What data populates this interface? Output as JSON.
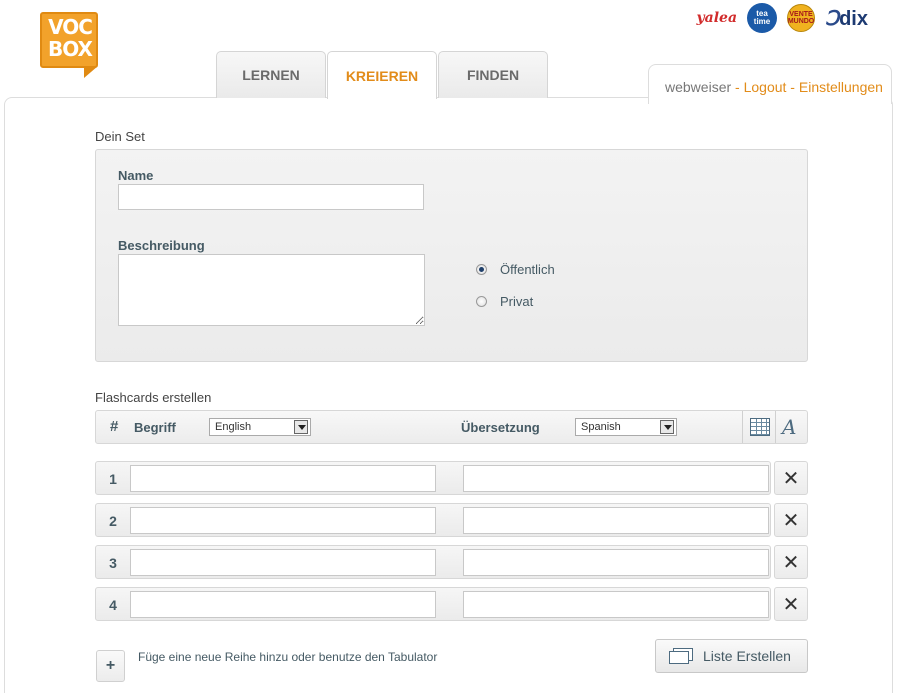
{
  "logo": {
    "text_line1": "VOC",
    "text_line2": "BOX"
  },
  "partners": {
    "yalea": "yalea",
    "teatime": "tea time",
    "vente": "VENTE MUNDO",
    "dix": "dix"
  },
  "tabs": [
    {
      "label": "LERNEN"
    },
    {
      "label": "KREIEREN",
      "active": true
    },
    {
      "label": "FINDEN"
    }
  ],
  "user": {
    "name": "webweiser",
    "separator": " - ",
    "logout": "Logout",
    "settings": "Einstellungen"
  },
  "set": {
    "section_title": "Dein Set",
    "name_label": "Name",
    "name_value": "",
    "desc_label": "Beschreibung",
    "desc_value": "",
    "visibility": [
      {
        "label": "Öffentlich",
        "checked": true
      },
      {
        "label": "Privat",
        "checked": false
      }
    ]
  },
  "flashcards": {
    "section_title": "Flashcards erstellen",
    "hash": "#",
    "term_label": "Begriff",
    "term_language": "English",
    "translation_label": "Übersetzung",
    "translation_language": "Spanish",
    "rows": [
      {
        "num": "1",
        "term": "",
        "translation": ""
      },
      {
        "num": "2",
        "term": "",
        "translation": ""
      },
      {
        "num": "3",
        "term": "",
        "translation": ""
      },
      {
        "num": "4",
        "term": "",
        "translation": ""
      }
    ],
    "delete_symbol": "✕"
  },
  "footer": {
    "add_symbol": "+",
    "add_hint": "Füge eine neue Reihe hinzu oder benutze den Tabulator",
    "create_label": "Liste Erstellen"
  },
  "icons": {
    "table": "table-icon",
    "font": "font-icon",
    "create": "cards-icon",
    "delete": "close-icon"
  },
  "colors": {
    "accent": "#e28c1a",
    "label": "#455a64"
  }
}
